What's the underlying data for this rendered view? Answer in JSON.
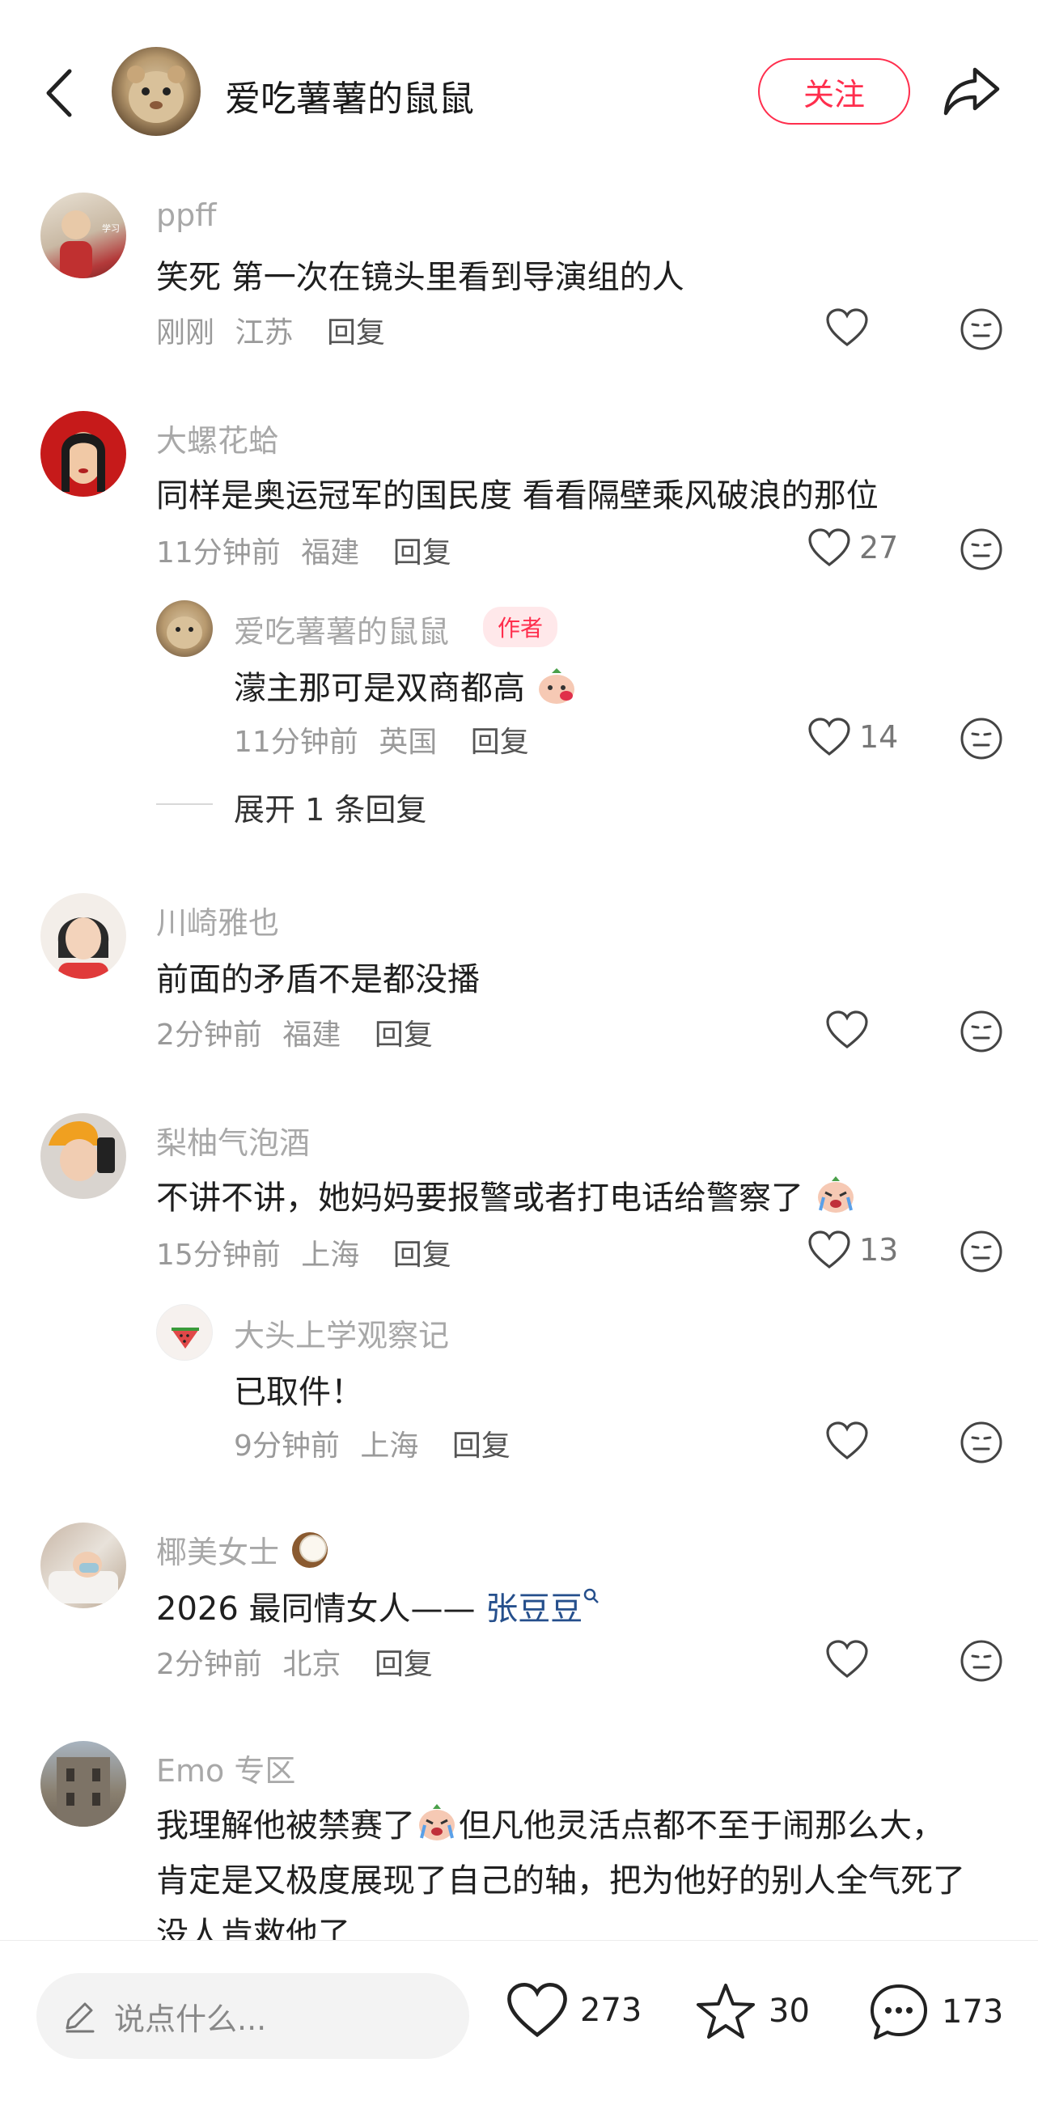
{
  "header": {
    "title": "爱吃薯薯的鼠鼠",
    "follow_label": "关注"
  },
  "comments": [
    {
      "username": "ppff",
      "text": "笑死 第一次在镜头里看到导演组的人",
      "time": "刚刚",
      "location": "江苏",
      "reply_label": "回复",
      "likes": ""
    },
    {
      "username": "大螺花蛤",
      "text": "同样是奥运冠军的国民度 看看隔壁乘风破浪的那位",
      "time": "11分钟前",
      "location": "福建",
      "reply_label": "回复",
      "likes": "27",
      "sub_reply": {
        "username": "爱吃薯薯的鼠鼠",
        "tag": "作者",
        "text": "濛主那可是双商都高",
        "time": "11分钟前",
        "location": "英国",
        "reply_label": "回复",
        "likes": "14"
      },
      "expand_label": "展开 1 条回复"
    },
    {
      "username": "川崎雅也",
      "text": "前面的矛盾不是都没播",
      "time": "2分钟前",
      "location": "福建",
      "reply_label": "回复",
      "likes": ""
    },
    {
      "username": "梨柚气泡酒",
      "text": "不讲不讲，她妈妈要报警或者打电话给警察了",
      "time": "15分钟前",
      "location": "上海",
      "reply_label": "回复",
      "likes": "13",
      "sub_reply": {
        "username": "大头上学观察记",
        "text": "已取件！",
        "time": "9分钟前",
        "location": "上海",
        "reply_label": "回复",
        "likes": ""
      }
    },
    {
      "username": "椰美女士",
      "text_prefix": "2026 最同情女人—— ",
      "text_link": "张豆豆",
      "time": "2分钟前",
      "location": "北京",
      "reply_label": "回复",
      "likes": ""
    },
    {
      "username": "Emo 专区",
      "text_line1a": "我理解他被禁赛了",
      "text_line1b": "但凡他灵活点都不至于闹那么大，",
      "text_line2": "肯定是又极度展现了自己的轴，把为他好的别人全气死了",
      "text_line3": "没人肯救他了"
    }
  ],
  "bottom_bar": {
    "input_placeholder": "说点什么...",
    "likes": "273",
    "favorites": "30",
    "comments": "173"
  },
  "colors": {
    "accent": "#ff2e4d",
    "link": "#254f8c"
  }
}
